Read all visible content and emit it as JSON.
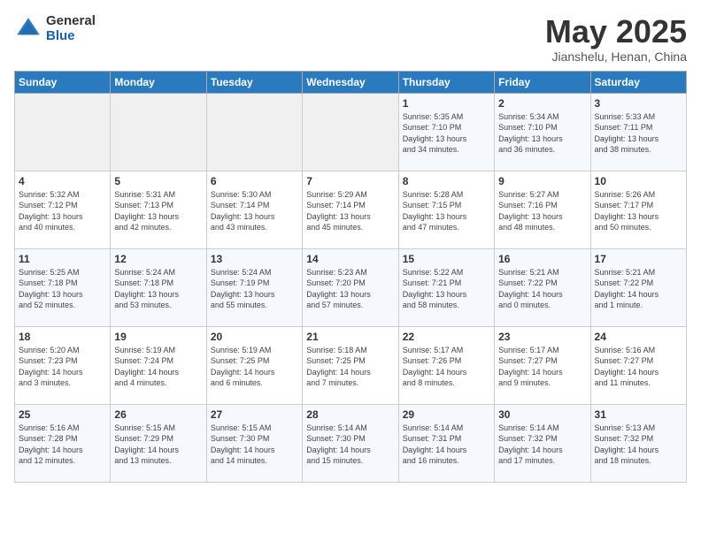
{
  "header": {
    "logo_general": "General",
    "logo_blue": "Blue",
    "month_title": "May 2025",
    "location": "Jianshelu, Henan, China"
  },
  "days_of_week": [
    "Sunday",
    "Monday",
    "Tuesday",
    "Wednesday",
    "Thursday",
    "Friday",
    "Saturday"
  ],
  "weeks": [
    [
      {
        "day": "",
        "content": ""
      },
      {
        "day": "",
        "content": ""
      },
      {
        "day": "",
        "content": ""
      },
      {
        "day": "",
        "content": ""
      },
      {
        "day": "1",
        "content": "Sunrise: 5:35 AM\nSunset: 7:10 PM\nDaylight: 13 hours\nand 34 minutes."
      },
      {
        "day": "2",
        "content": "Sunrise: 5:34 AM\nSunset: 7:10 PM\nDaylight: 13 hours\nand 36 minutes."
      },
      {
        "day": "3",
        "content": "Sunrise: 5:33 AM\nSunset: 7:11 PM\nDaylight: 13 hours\nand 38 minutes."
      }
    ],
    [
      {
        "day": "4",
        "content": "Sunrise: 5:32 AM\nSunset: 7:12 PM\nDaylight: 13 hours\nand 40 minutes."
      },
      {
        "day": "5",
        "content": "Sunrise: 5:31 AM\nSunset: 7:13 PM\nDaylight: 13 hours\nand 42 minutes."
      },
      {
        "day": "6",
        "content": "Sunrise: 5:30 AM\nSunset: 7:14 PM\nDaylight: 13 hours\nand 43 minutes."
      },
      {
        "day": "7",
        "content": "Sunrise: 5:29 AM\nSunset: 7:14 PM\nDaylight: 13 hours\nand 45 minutes."
      },
      {
        "day": "8",
        "content": "Sunrise: 5:28 AM\nSunset: 7:15 PM\nDaylight: 13 hours\nand 47 minutes."
      },
      {
        "day": "9",
        "content": "Sunrise: 5:27 AM\nSunset: 7:16 PM\nDaylight: 13 hours\nand 48 minutes."
      },
      {
        "day": "10",
        "content": "Sunrise: 5:26 AM\nSunset: 7:17 PM\nDaylight: 13 hours\nand 50 minutes."
      }
    ],
    [
      {
        "day": "11",
        "content": "Sunrise: 5:25 AM\nSunset: 7:18 PM\nDaylight: 13 hours\nand 52 minutes."
      },
      {
        "day": "12",
        "content": "Sunrise: 5:24 AM\nSunset: 7:18 PM\nDaylight: 13 hours\nand 53 minutes."
      },
      {
        "day": "13",
        "content": "Sunrise: 5:24 AM\nSunset: 7:19 PM\nDaylight: 13 hours\nand 55 minutes."
      },
      {
        "day": "14",
        "content": "Sunrise: 5:23 AM\nSunset: 7:20 PM\nDaylight: 13 hours\nand 57 minutes."
      },
      {
        "day": "15",
        "content": "Sunrise: 5:22 AM\nSunset: 7:21 PM\nDaylight: 13 hours\nand 58 minutes."
      },
      {
        "day": "16",
        "content": "Sunrise: 5:21 AM\nSunset: 7:22 PM\nDaylight: 14 hours\nand 0 minutes."
      },
      {
        "day": "17",
        "content": "Sunrise: 5:21 AM\nSunset: 7:22 PM\nDaylight: 14 hours\nand 1 minute."
      }
    ],
    [
      {
        "day": "18",
        "content": "Sunrise: 5:20 AM\nSunset: 7:23 PM\nDaylight: 14 hours\nand 3 minutes."
      },
      {
        "day": "19",
        "content": "Sunrise: 5:19 AM\nSunset: 7:24 PM\nDaylight: 14 hours\nand 4 minutes."
      },
      {
        "day": "20",
        "content": "Sunrise: 5:19 AM\nSunset: 7:25 PM\nDaylight: 14 hours\nand 6 minutes."
      },
      {
        "day": "21",
        "content": "Sunrise: 5:18 AM\nSunset: 7:25 PM\nDaylight: 14 hours\nand 7 minutes."
      },
      {
        "day": "22",
        "content": "Sunrise: 5:17 AM\nSunset: 7:26 PM\nDaylight: 14 hours\nand 8 minutes."
      },
      {
        "day": "23",
        "content": "Sunrise: 5:17 AM\nSunset: 7:27 PM\nDaylight: 14 hours\nand 9 minutes."
      },
      {
        "day": "24",
        "content": "Sunrise: 5:16 AM\nSunset: 7:27 PM\nDaylight: 14 hours\nand 11 minutes."
      }
    ],
    [
      {
        "day": "25",
        "content": "Sunrise: 5:16 AM\nSunset: 7:28 PM\nDaylight: 14 hours\nand 12 minutes."
      },
      {
        "day": "26",
        "content": "Sunrise: 5:15 AM\nSunset: 7:29 PM\nDaylight: 14 hours\nand 13 minutes."
      },
      {
        "day": "27",
        "content": "Sunrise: 5:15 AM\nSunset: 7:30 PM\nDaylight: 14 hours\nand 14 minutes."
      },
      {
        "day": "28",
        "content": "Sunrise: 5:14 AM\nSunset: 7:30 PM\nDaylight: 14 hours\nand 15 minutes."
      },
      {
        "day": "29",
        "content": "Sunrise: 5:14 AM\nSunset: 7:31 PM\nDaylight: 14 hours\nand 16 minutes."
      },
      {
        "day": "30",
        "content": "Sunrise: 5:14 AM\nSunset: 7:32 PM\nDaylight: 14 hours\nand 17 minutes."
      },
      {
        "day": "31",
        "content": "Sunrise: 5:13 AM\nSunset: 7:32 PM\nDaylight: 14 hours\nand 18 minutes."
      }
    ]
  ]
}
